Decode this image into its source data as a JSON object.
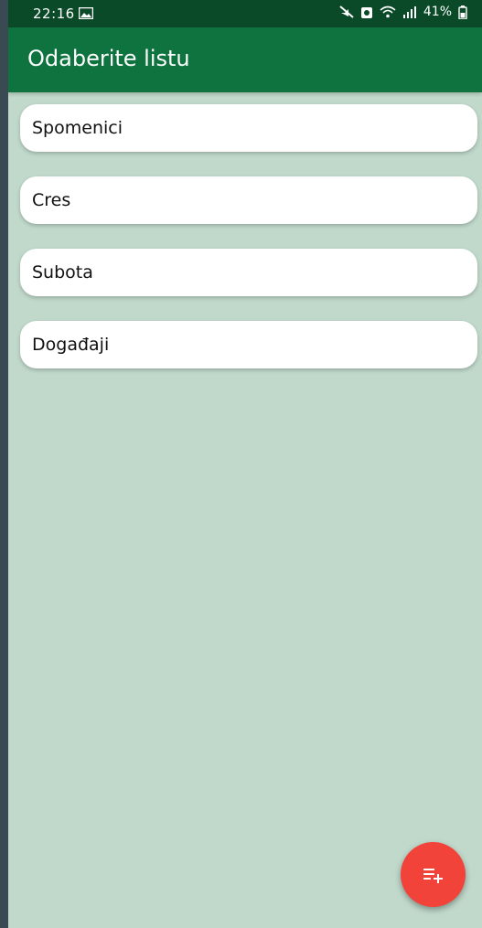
{
  "status_bar": {
    "time": "22:16",
    "battery": "41%",
    "icons": [
      "image-icon",
      "mute-icon",
      "alarm-icon",
      "wifi-icon",
      "signal-icon",
      "battery-icon"
    ]
  },
  "app_bar": {
    "title": "Odaberite listu"
  },
  "lists": [
    {
      "label": "Spomenici"
    },
    {
      "label": "Cres"
    },
    {
      "label": "Subota"
    },
    {
      "label": "Događaji"
    }
  ],
  "fab": {
    "icon": "playlist-add-icon"
  },
  "colors": {
    "status_bar": "#0b4a28",
    "app_bar": "#0e733e",
    "background": "#c0d9cb",
    "fab": "#f2433a",
    "card": "#ffffff"
  }
}
